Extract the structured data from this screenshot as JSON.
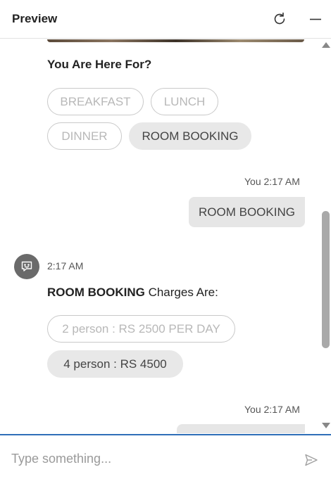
{
  "header": {
    "title": "Preview",
    "refresh_icon": "refresh-icon",
    "minimize_icon": "minimize-icon"
  },
  "chat": {
    "question": "You Are Here For?",
    "options": [
      "BREAKFAST",
      "LUNCH",
      "DINNER",
      "ROOM BOOKING"
    ],
    "selected_option": "ROOM BOOKING",
    "user_message_1": {
      "meta": "You 2:17 AM",
      "text": "ROOM BOOKING"
    },
    "bot_message": {
      "time": "2:17 AM",
      "bold": "ROOM BOOKING",
      "rest": " Charges Are:",
      "options": [
        "2 person : RS 2500 PER DAY",
        "4 person : RS 4500"
      ],
      "selected_option": "4 person : RS 4500"
    },
    "user_message_2": {
      "meta": "You 2:17 AM"
    }
  },
  "composer": {
    "placeholder": "Type something...",
    "send_icon": "send-icon"
  },
  "colors": {
    "accent": "#2f6fb8",
    "pill_filled": "#e8e8e8",
    "avatar": "#6a6a6a"
  }
}
